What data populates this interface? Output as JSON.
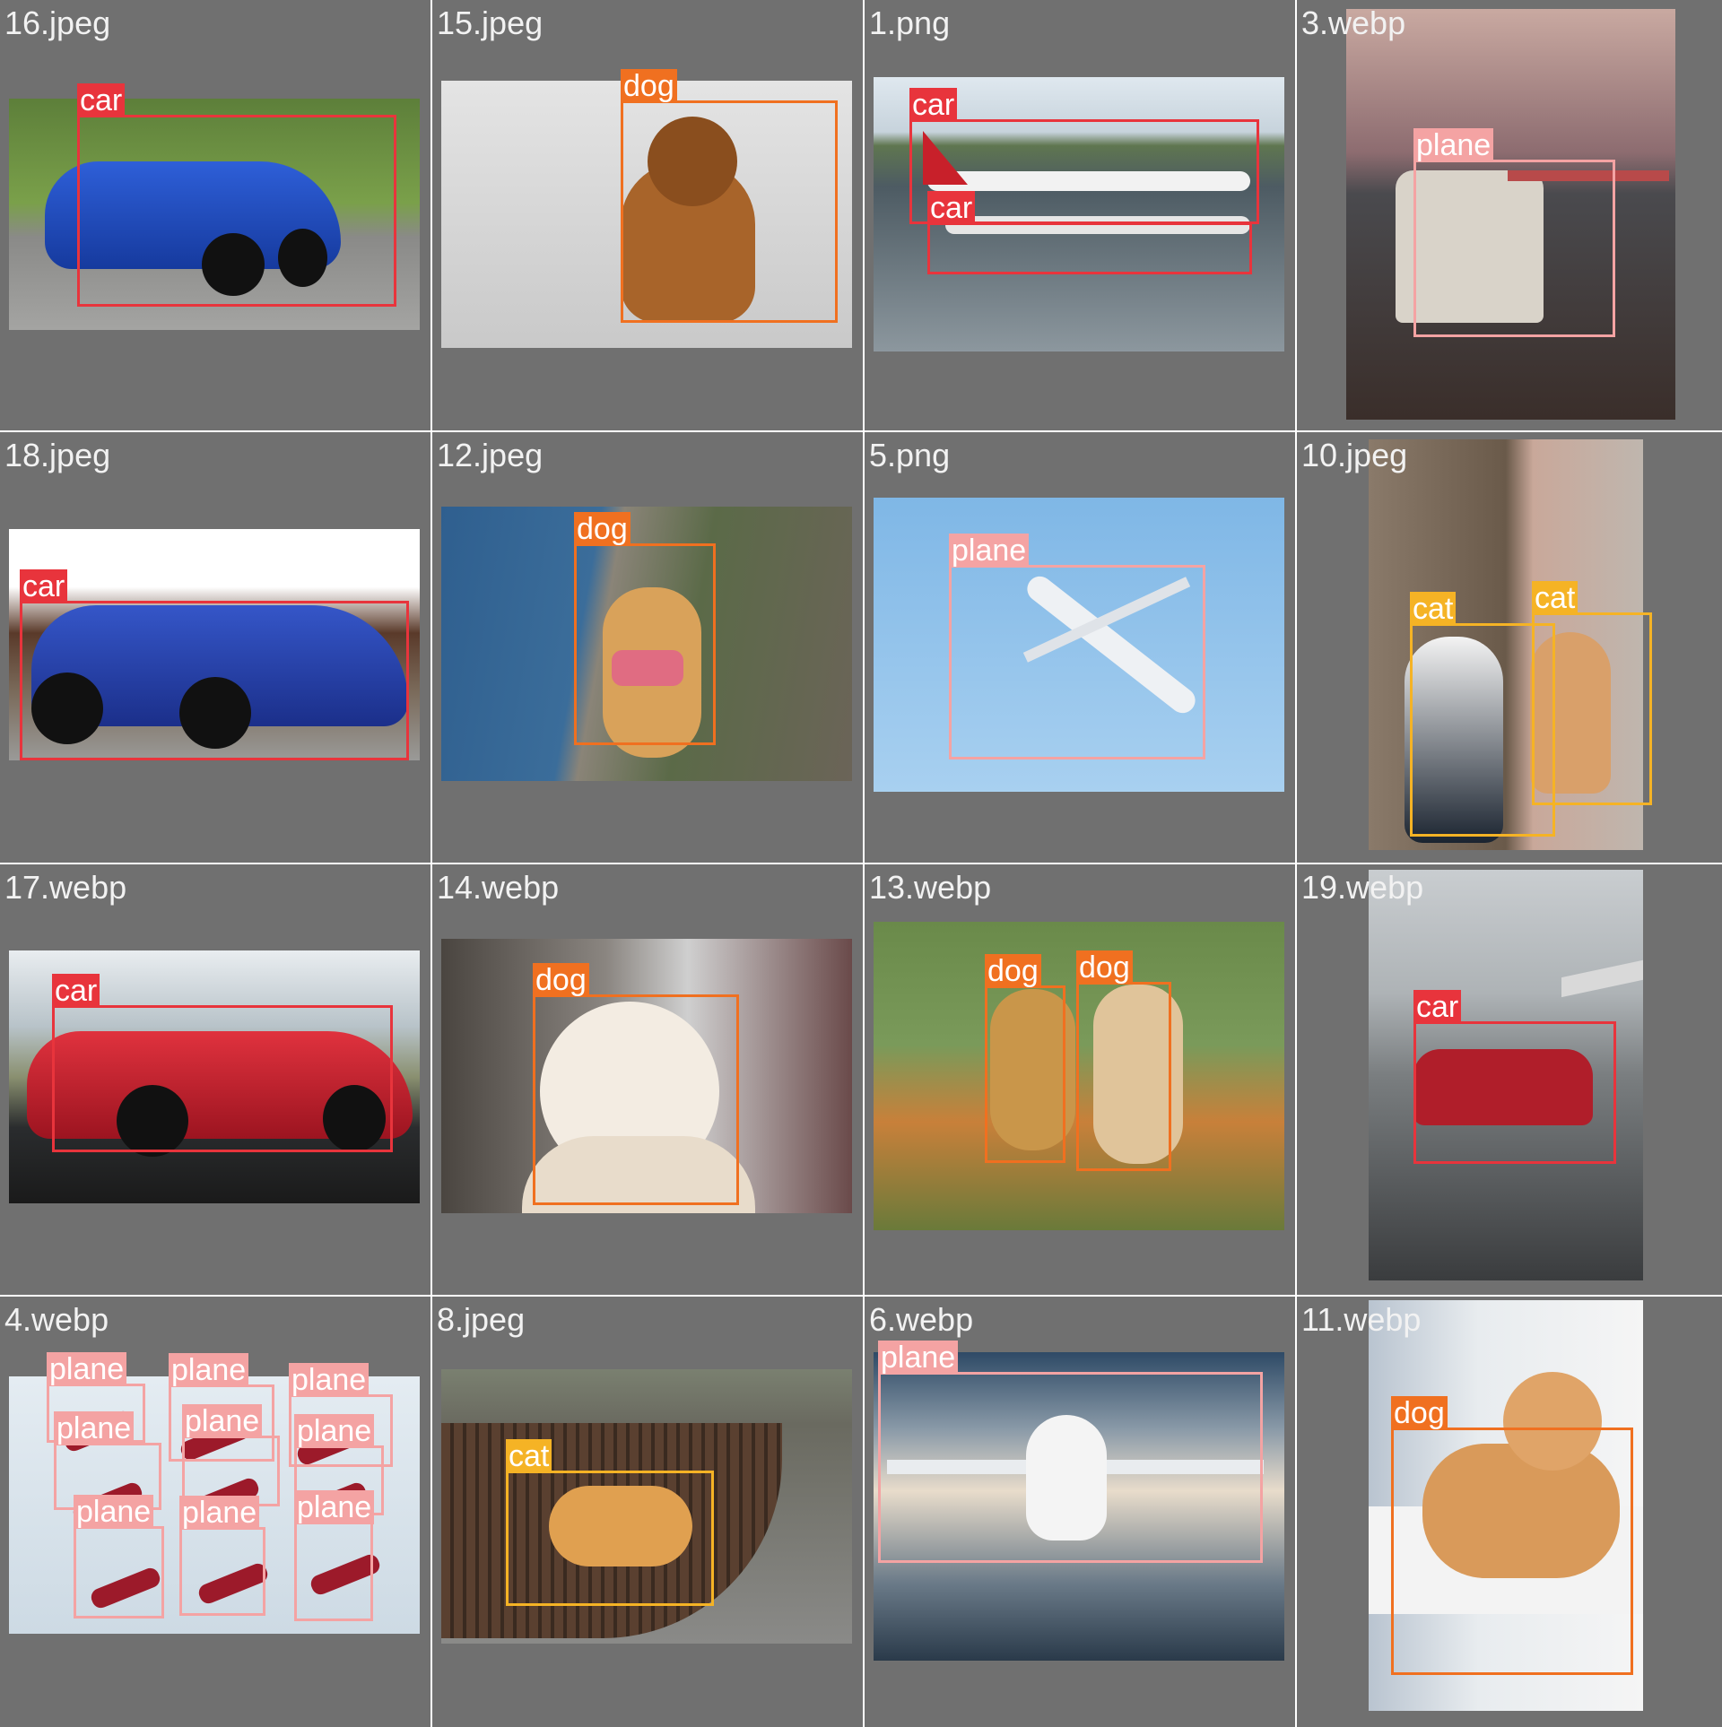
{
  "classes": {
    "car": {
      "label": "car",
      "color": "#e8343c"
    },
    "dog": {
      "label": "dog",
      "color": "#f07020"
    },
    "plane": {
      "label": "plane",
      "color": "#f4a3a3"
    },
    "cat": {
      "label": "cat",
      "color": "#f5b325"
    }
  },
  "tiles": [
    {
      "name": "16.jpeg",
      "subject": "blue-sedan",
      "detections": [
        "car"
      ]
    },
    {
      "name": "15.jpeg",
      "subject": "brown-puppy",
      "detections": [
        "dog"
      ]
    },
    {
      "name": "1.png",
      "subject": "airport-planes",
      "detections": [
        "car",
        "car"
      ]
    },
    {
      "name": "3.webp",
      "subject": "white-van",
      "detections": [
        "plane"
      ]
    },
    {
      "name": "18.jpeg",
      "subject": "blue-audi",
      "detections": [
        "car"
      ]
    },
    {
      "name": "12.jpeg",
      "subject": "corgi",
      "detections": [
        "dog"
      ]
    },
    {
      "name": "5.png",
      "subject": "jet-in-sky",
      "detections": [
        "plane"
      ]
    },
    {
      "name": "10.jpeg",
      "subject": "two-cats-tree",
      "detections": [
        "cat",
        "cat"
      ]
    },
    {
      "name": "17.webp",
      "subject": "red-sports-car",
      "detections": [
        "car"
      ]
    },
    {
      "name": "14.webp",
      "subject": "golden-retriever",
      "detections": [
        "dog"
      ]
    },
    {
      "name": "13.webp",
      "subject": "two-puppies",
      "detections": [
        "dog",
        "dog"
      ]
    },
    {
      "name": "19.webp",
      "subject": "red-muscle-car",
      "detections": [
        "car"
      ]
    },
    {
      "name": "4.webp",
      "subject": "jet-formation",
      "detections": [
        "plane",
        "plane",
        "plane",
        "plane",
        "plane",
        "plane",
        "plane",
        "plane",
        "plane"
      ]
    },
    {
      "name": "8.jpeg",
      "subject": "cat-on-bench",
      "detections": [
        "cat"
      ]
    },
    {
      "name": "6.webp",
      "subject": "airliner-clouds",
      "detections": [
        "plane"
      ]
    },
    {
      "name": "11.webp",
      "subject": "shiba-puppy",
      "detections": [
        "dog"
      ]
    }
  ]
}
